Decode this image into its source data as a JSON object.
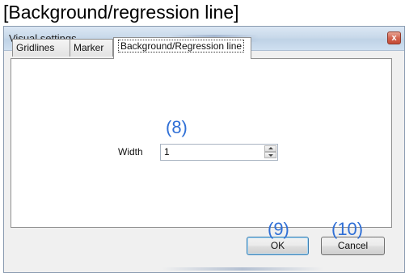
{
  "caption": "[Background/regression line]",
  "window": {
    "title": "Visual settings",
    "close_glyph": "x"
  },
  "tabs": [
    {
      "label": "Gridlines",
      "active": false
    },
    {
      "label": "Marker",
      "active": false
    },
    {
      "label": "Background/Regression line",
      "active": true
    }
  ],
  "annotations": {
    "width_marker": "(8)",
    "ok_marker": "(9)",
    "cancel_marker": "(10)",
    "color": "#2f6fd6"
  },
  "width_field": {
    "label": "Width",
    "value": "1"
  },
  "buttons": {
    "ok": "OK",
    "cancel": "Cancel"
  },
  "icons": {
    "close": "close-icon",
    "spin_up": "spin-up-arrow-icon",
    "spin_down": "spin-down-arrow-icon"
  }
}
